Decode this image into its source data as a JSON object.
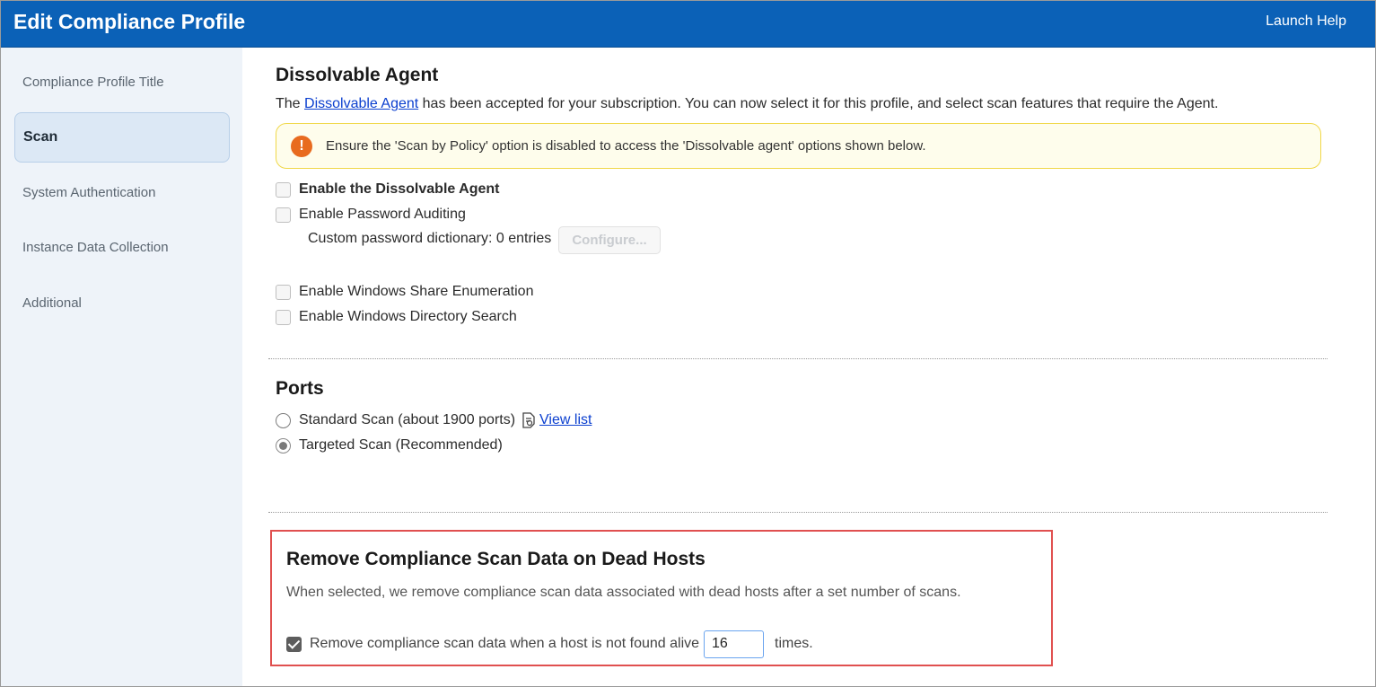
{
  "header": {
    "title": "Edit Compliance Profile",
    "help": "Launch Help"
  },
  "sidebar": {
    "items": [
      {
        "label": "Compliance Profile Title"
      },
      {
        "label": "Scan"
      },
      {
        "label": "System Authentication"
      },
      {
        "label": "Instance Data Collection"
      },
      {
        "label": "Additional"
      }
    ],
    "active": "Scan"
  },
  "agent": {
    "heading": "Dissolvable Agent",
    "intro_prefix": "The ",
    "intro_link": "Dissolvable Agent",
    "intro_suffix": " has been accepted for your subscription. You can now select it for this profile, and select scan features that require the Agent.",
    "warning_icon": "!",
    "warning": "Ensure the 'Scan by Policy' option is disabled to access the 'Dissolvable agent' options shown below.",
    "enable_agent": "Enable the Dissolvable Agent",
    "enable_password": "Enable Password Auditing",
    "dictionary": "Custom password dictionary: 0 entries",
    "configure": "Configure...",
    "share_enum": "Enable Windows Share Enumeration",
    "dir_search": "Enable Windows Directory Search"
  },
  "ports": {
    "heading": "Ports",
    "standard": "Standard Scan (about 1900 ports)",
    "view_list": "View list",
    "targeted": "Targeted Scan (Recommended)",
    "selected": "targeted"
  },
  "remove": {
    "heading": "Remove Compliance Scan Data on Dead Hosts",
    "description": "When selected, we remove compliance scan data associated with dead hosts after a set number of scans.",
    "checkbox_label": "Remove compliance scan data when a host is not found alive",
    "checked": true,
    "times_value": "16",
    "times_suffix": "times."
  },
  "colors": {
    "header": "#0b61b7",
    "sidebar": "#eef3f9",
    "warning_icon": "#e86b1f",
    "highlight_box": "#e0504f",
    "link": "#0b3fcf"
  }
}
